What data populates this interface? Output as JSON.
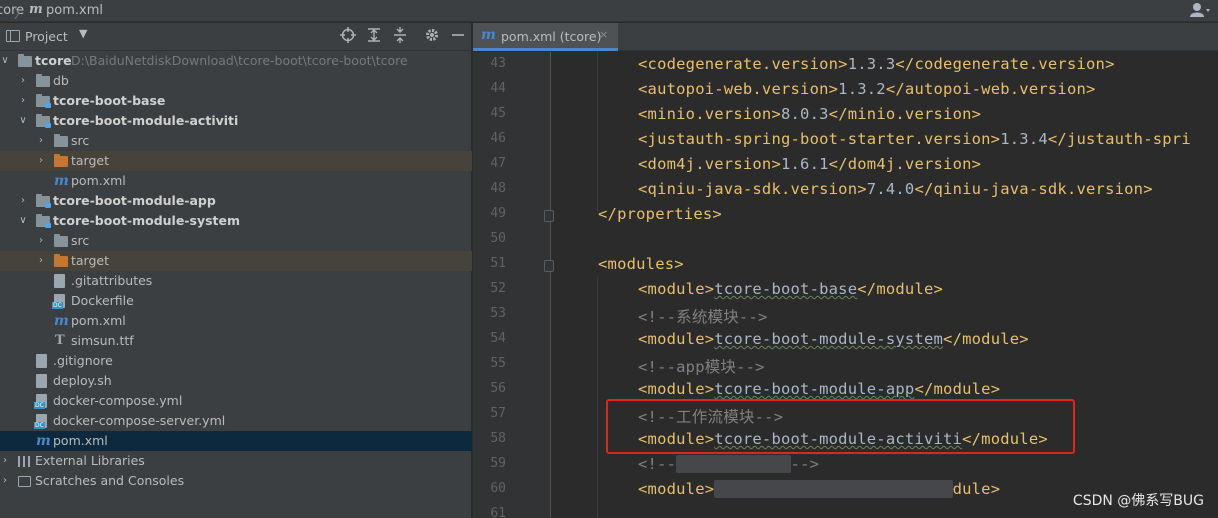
{
  "breadcrumb": {
    "project": "core",
    "separator": "〉",
    "file_icon": "m",
    "file": "pom.xml"
  },
  "topbar": {
    "user_icon": "user-icon"
  },
  "project_pane": {
    "title": "Project",
    "dropdown_glyph": "▼",
    "toolbar_icons": [
      "locate-icon",
      "expand-all-icon",
      "collapse-all-icon",
      "gear-icon",
      "hide-icon"
    ],
    "tree": [
      {
        "label": "tcore",
        "path": "D:\\BaiduNetdiskDownload\\tcore-boot\\tcore-boot\\tcore",
        "arrow": "∨",
        "icon": "folder",
        "bold": true
      },
      {
        "label": "db",
        "arrow": "›",
        "icon": "folder"
      },
      {
        "label": "tcore-boot-base",
        "arrow": "›",
        "icon": "module-folder",
        "bold": true
      },
      {
        "label": "tcore-boot-module-activiti",
        "arrow": "∨",
        "icon": "module-folder",
        "bold": true
      },
      {
        "label": "src",
        "arrow": "›",
        "icon": "folder"
      },
      {
        "label": "target",
        "arrow": "›",
        "icon": "orange-folder",
        "highlight": true
      },
      {
        "label": "pom.xml",
        "arrow": "",
        "icon": "maven"
      },
      {
        "label": "tcore-boot-module-app",
        "arrow": "›",
        "icon": "module-folder",
        "bold": true
      },
      {
        "label": "tcore-boot-module-system",
        "arrow": "∨",
        "icon": "module-folder",
        "bold": true
      },
      {
        "label": "src",
        "arrow": "›",
        "icon": "folder"
      },
      {
        "label": "target",
        "arrow": "›",
        "icon": "orange-folder",
        "highlight": true
      },
      {
        "label": ".gitattributes",
        "arrow": "",
        "icon": "file"
      },
      {
        "label": "Dockerfile",
        "arrow": "",
        "icon": "docker-file"
      },
      {
        "label": "pom.xml",
        "arrow": "",
        "icon": "maven"
      },
      {
        "label": "simsun.ttf",
        "arrow": "",
        "icon": "font"
      },
      {
        "label": ".gitignore",
        "arrow": "",
        "icon": "file"
      },
      {
        "label": "deploy.sh",
        "arrow": "",
        "icon": "shell"
      },
      {
        "label": "docker-compose.yml",
        "arrow": "",
        "icon": "docker-file"
      },
      {
        "label": "docker-compose-server.yml",
        "arrow": "",
        "icon": "docker-file"
      },
      {
        "label": "pom.xml",
        "arrow": "",
        "icon": "maven",
        "selected": true
      },
      {
        "label": "External Libraries",
        "arrow": "›",
        "icon": "library"
      },
      {
        "label": "Scratches and Consoles",
        "arrow": "›",
        "icon": "scratches"
      }
    ]
  },
  "editor_tab": {
    "icon": "m",
    "label": "pom.xml (tcore)",
    "close": "×"
  },
  "editor": {
    "lines": [
      {
        "n": "43",
        "segs": [
          [
            "tag",
            "<codegenerate.version>"
          ],
          [
            "txt",
            "1.3.3"
          ],
          [
            "tag",
            "</codegenerate.version>"
          ]
        ]
      },
      {
        "n": "44",
        "segs": [
          [
            "tag",
            "<autopoi-web.version>"
          ],
          [
            "txt",
            "1.3.2"
          ],
          [
            "tag",
            "</autopoi-web.version>"
          ]
        ]
      },
      {
        "n": "45",
        "segs": [
          [
            "tag",
            "<minio.version>"
          ],
          [
            "txt",
            "8.0.3"
          ],
          [
            "tag",
            "</minio.version>"
          ]
        ]
      },
      {
        "n": "46",
        "segs": [
          [
            "tag",
            "<justauth-spring-boot-starter.version>"
          ],
          [
            "txt",
            "1.3.4"
          ],
          [
            "tag",
            "</justauth-spri"
          ]
        ]
      },
      {
        "n": "47",
        "segs": [
          [
            "tag",
            "<dom4j.version>"
          ],
          [
            "txt",
            "1.6.1"
          ],
          [
            "tag",
            "</dom4j.version>"
          ]
        ]
      },
      {
        "n": "48",
        "segs": [
          [
            "tag",
            "<qiniu-java-sdk.version>"
          ],
          [
            "txt",
            "7.4.0"
          ],
          [
            "tag",
            "</qiniu-java-sdk.version>"
          ]
        ]
      },
      {
        "n": "49",
        "segs": [
          [
            "tag",
            "</properties>"
          ]
        ]
      },
      {
        "n": "50",
        "segs": []
      },
      {
        "n": "51",
        "segs": [
          [
            "tag",
            "<modules>"
          ]
        ]
      },
      {
        "n": "52",
        "segs": [
          [
            "tag",
            "<module>"
          ],
          [
            "txt",
            "tcore-boot-base"
          ],
          [
            "tag",
            "</module>"
          ]
        ]
      },
      {
        "n": "53",
        "segs": [
          [
            "cmt",
            "<!--系统模块-->"
          ]
        ]
      },
      {
        "n": "54",
        "segs": [
          [
            "tag",
            "<module>"
          ],
          [
            "txt",
            "tcore-boot-module-system"
          ],
          [
            "tag",
            "</module>"
          ]
        ]
      },
      {
        "n": "55",
        "segs": [
          [
            "cmt",
            "<!--app模块-->"
          ]
        ]
      },
      {
        "n": "56",
        "segs": [
          [
            "tag",
            "<module>"
          ],
          [
            "txt",
            "tcore-boot-module-app"
          ],
          [
            "tag",
            "</module>"
          ]
        ]
      },
      {
        "n": "57",
        "segs": [
          [
            "cmt",
            "<!--工作流模块-->"
          ]
        ]
      },
      {
        "n": "58",
        "segs": [
          [
            "tag",
            "<module>"
          ],
          [
            "txt",
            "tcore-boot-module-activiti"
          ],
          [
            "tag",
            "</module>"
          ]
        ]
      },
      {
        "n": "59",
        "segs": [
          [
            "cmt",
            "<!--"
          ],
          [
            "gap",
            "            "
          ],
          [
            "cmt",
            "-->"
          ]
        ]
      },
      {
        "n": "60",
        "segs": [
          [
            "tag",
            "<module>"
          ],
          [
            "gap",
            "                         "
          ],
          [
            "tag",
            "dule>"
          ]
        ]
      },
      {
        "n": "61",
        "segs": []
      }
    ]
  },
  "watermark": "CSDN @佛系写BUG",
  "colors": {
    "tag": "#e8bf6a",
    "text": "#a9b7c6",
    "comment": "#808080",
    "annotation_box": "#e0251b"
  }
}
